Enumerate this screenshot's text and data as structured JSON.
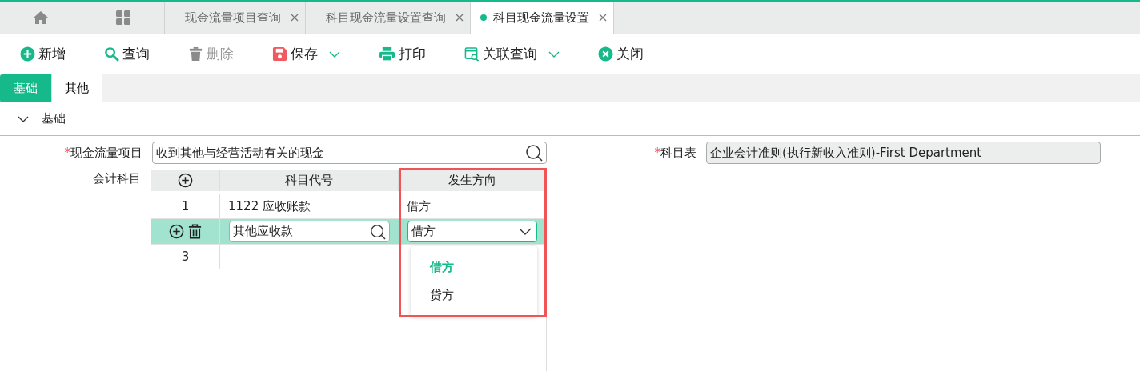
{
  "tabs": [
    {
      "label": "现金流量项目查询",
      "selected": false
    },
    {
      "label": "科目现金流量设置查询",
      "selected": false
    },
    {
      "label": "科目现金流量设置",
      "selected": true
    }
  ],
  "toolbar": [
    {
      "kind": "add",
      "label": "新增",
      "disabled": false,
      "menu": false
    },
    {
      "kind": "search",
      "label": "查询",
      "disabled": false,
      "menu": false
    },
    {
      "kind": "delete",
      "label": "删除",
      "disabled": true,
      "menu": false
    },
    {
      "kind": "save",
      "label": "保存",
      "disabled": false,
      "menu": true
    },
    {
      "kind": "print",
      "label": "打印",
      "disabled": false,
      "menu": false
    },
    {
      "kind": "related",
      "label": "关联查询",
      "disabled": false,
      "menu": true
    },
    {
      "kind": "close",
      "label": "关闭",
      "disabled": false,
      "menu": false
    }
  ],
  "form_tabs": [
    {
      "label": "基础",
      "selected": true
    },
    {
      "label": "其他",
      "selected": false
    }
  ],
  "section": {
    "title": "基础",
    "expanded": true
  },
  "cash_flow_item": {
    "label": "现金流量项目",
    "required_mark": "*",
    "value": "收到其他与经营活动有关的现金"
  },
  "subject_table": {
    "label": "科目表",
    "required_mark": "*",
    "value": "企业会计准则(执行新收入准则)-First Department",
    "disabled": true
  },
  "grid": {
    "label": "会计科目",
    "columns": [
      {
        "label": "科目代号",
        "highlighted": false
      },
      {
        "label": "发生方向",
        "highlighted": true
      }
    ],
    "rows": [
      {
        "kind": "view",
        "index": "1",
        "code": "1122 应收账款",
        "direction": "借方"
      },
      {
        "kind": "edit",
        "code": "其他应收款",
        "direction": "借方"
      },
      {
        "kind": "view",
        "index": "3"
      }
    ],
    "dropdown": {
      "options": [
        {
          "label": "借方",
          "selected": true
        },
        {
          "label": "贷方",
          "selected": false
        }
      ]
    }
  }
}
